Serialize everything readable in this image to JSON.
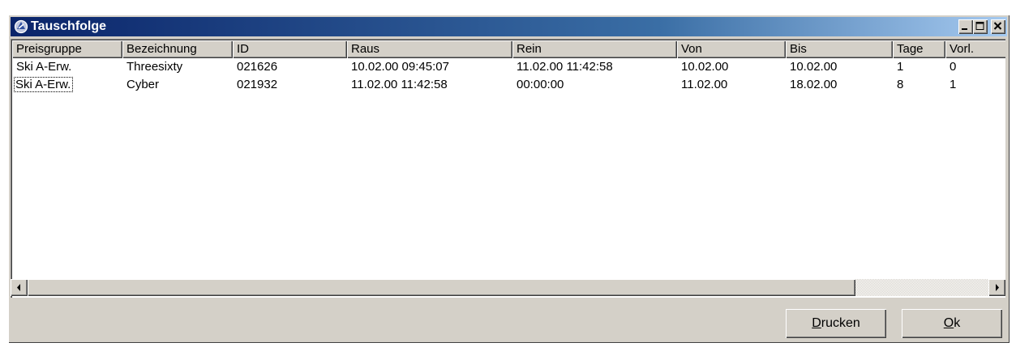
{
  "window": {
    "title": "Tauschfolge",
    "title_icon": "app-icon"
  },
  "columns": [
    {
      "label": "Preisgruppe"
    },
    {
      "label": "Bezeichnung"
    },
    {
      "label": "ID"
    },
    {
      "label": "Raus"
    },
    {
      "label": "Rein"
    },
    {
      "label": "Von"
    },
    {
      "label": "Bis"
    },
    {
      "label": "Tage"
    },
    {
      "label": "Vorl."
    }
  ],
  "rows": [
    {
      "cells": [
        "Ski A-Erw.",
        "Threesixty",
        "021626",
        "10.02.00 09:45:07",
        "11.02.00 11:42:58",
        "10.02.00",
        "10.02.00",
        "1",
        "0"
      ]
    },
    {
      "cells": [
        "Ski A-Erw.",
        "Cyber",
        "021932",
        "11.02.00 11:42:58",
        "00:00:00",
        "11.02.00",
        "18.02.00",
        "8",
        "1"
      ]
    }
  ],
  "buttons": {
    "drucken": {
      "mnemonic": "D",
      "rest": "rucken"
    },
    "ok": {
      "mnemonic": "O",
      "rest": "k"
    }
  },
  "colors": {
    "title_start": "#0a246a",
    "title_end": "#a6caf0",
    "face": "#d4d0c8"
  }
}
